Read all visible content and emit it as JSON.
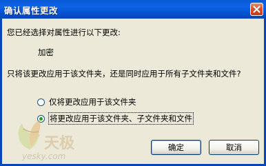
{
  "window": {
    "title": "确认属性更改",
    "close_glyph": "close-icon"
  },
  "content": {
    "intro": "您已经选择对属性进行以下更改:",
    "attribute": "加密",
    "question": "只将该更改应用于该文件夹，还是同时应用于所有子文件夹和文件?"
  },
  "options": [
    {
      "label": "仅将更改应用于该文件夹",
      "selected": false
    },
    {
      "label": "将更改应用于该文件夹、子文件夹和文件",
      "selected": true
    }
  ],
  "buttons": {
    "ok": "确定",
    "cancel": "取消"
  },
  "watermark": {
    "brand": "天极",
    "url": "yesky.com"
  },
  "colors": {
    "titlebar": "#0a5ad6",
    "dialog_bg": "#ece9d8",
    "radio_dot": "#21a121"
  }
}
